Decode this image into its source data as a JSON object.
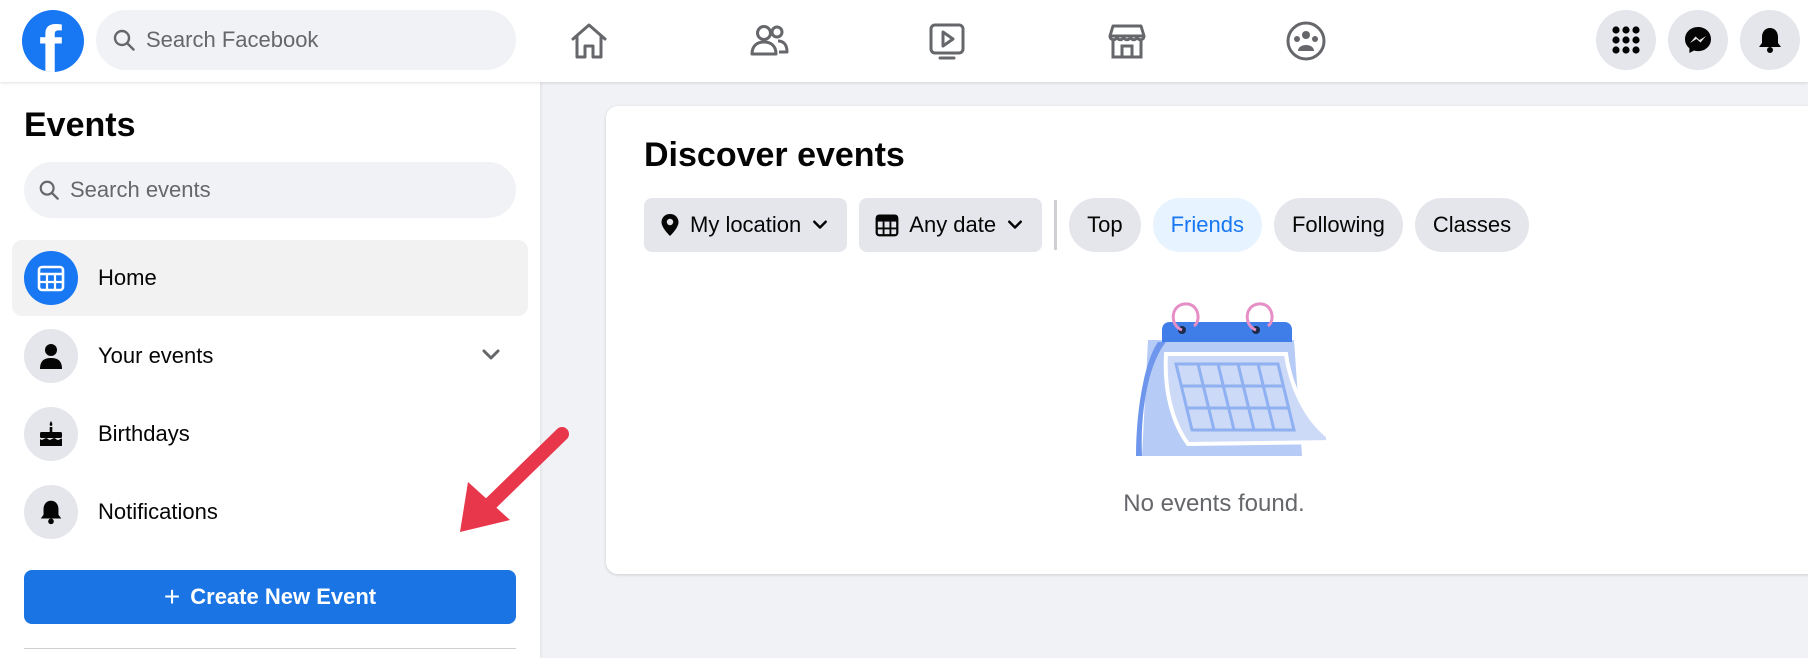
{
  "header": {
    "logo_letter": "f",
    "search_placeholder": "Search Facebook",
    "nav": [
      "home-icon",
      "friends-icon",
      "watch-icon",
      "marketplace-icon",
      "groups-icon"
    ],
    "actions": [
      "menu-grid-icon",
      "messenger-icon",
      "notifications-icon"
    ]
  },
  "sidebar": {
    "title": "Events",
    "search_placeholder": "Search events",
    "items": [
      {
        "label": "Home",
        "icon": "calendar-icon",
        "active": true
      },
      {
        "label": "Your events",
        "icon": "person-icon",
        "has_chevron": true
      },
      {
        "label": "Birthdays",
        "icon": "cake-icon"
      },
      {
        "label": "Notifications",
        "icon": "bell-icon"
      }
    ],
    "create_button_label": "Create New Event",
    "create_button_plus": "+"
  },
  "main": {
    "title": "Discover events",
    "location_filter": "My location",
    "date_filter": "Any date",
    "pills": [
      {
        "label": "Top",
        "selected": false
      },
      {
        "label": "Friends",
        "selected": true
      },
      {
        "label": "Following",
        "selected": false
      },
      {
        "label": "Classes",
        "selected": false
      }
    ],
    "empty_message": "No events found."
  },
  "colors": {
    "brand_blue": "#1877f2",
    "button_blue": "#1b74e4",
    "selected_pill_bg": "#e7f3ff",
    "annotation_arrow": "#e8364b"
  }
}
